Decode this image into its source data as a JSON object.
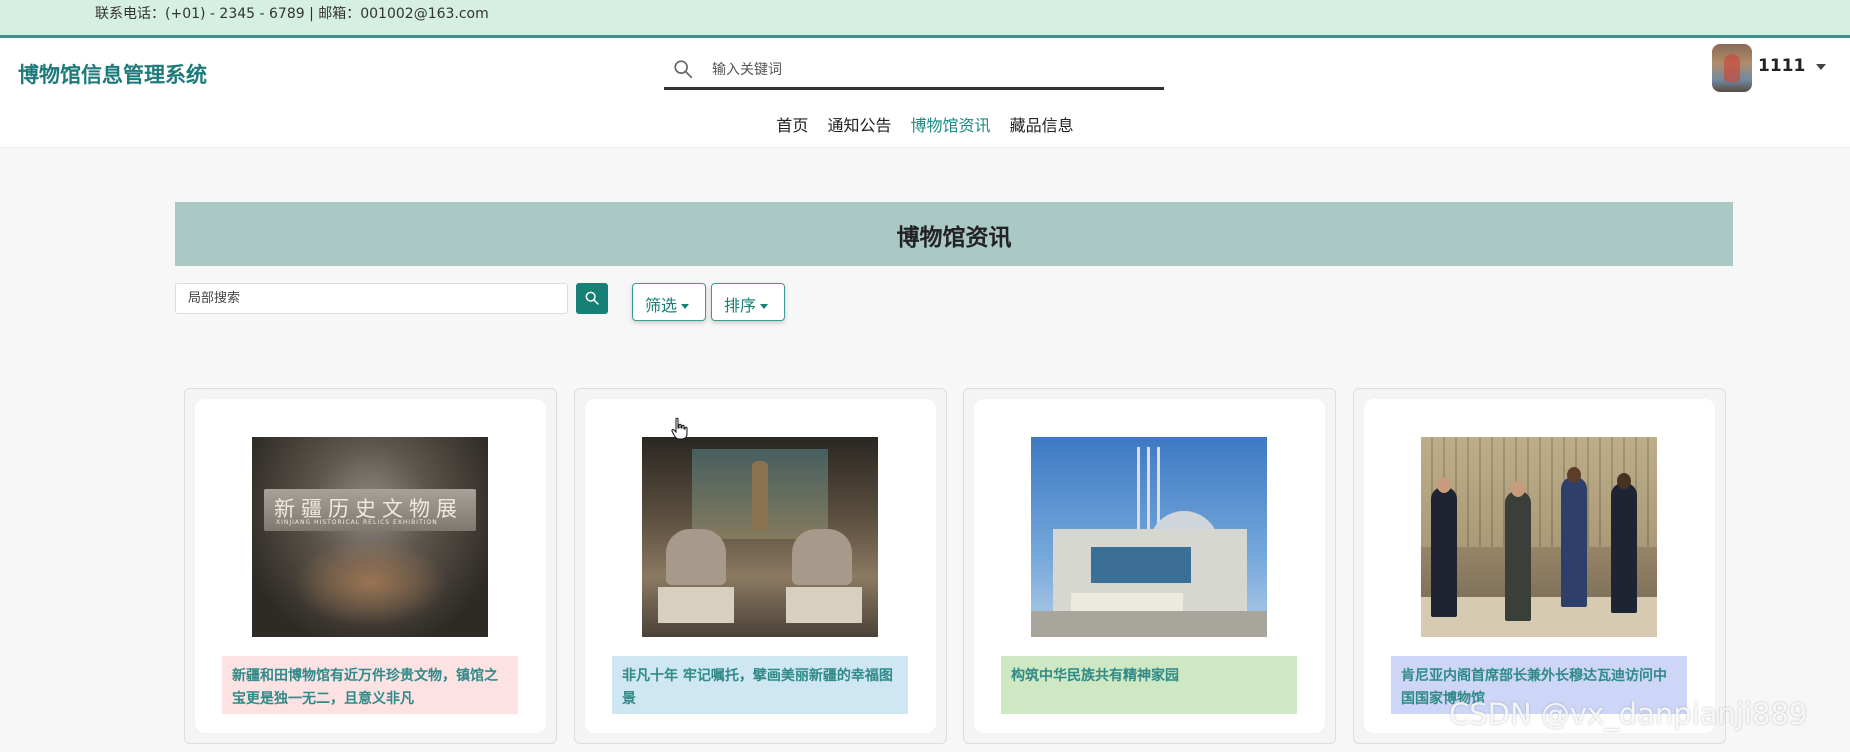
{
  "topbar": {
    "contact": "联系电话：(+01) - 2345 - 6789 | 邮箱：001002@163.com"
  },
  "header": {
    "logo": "博物馆信息管理系统",
    "search_placeholder": "输入关键词",
    "username": "1111"
  },
  "nav": {
    "items": [
      {
        "label": "首页",
        "active": false
      },
      {
        "label": "通知公告",
        "active": false
      },
      {
        "label": "博物馆资讯",
        "active": true
      },
      {
        "label": "藏品信息",
        "active": false
      }
    ]
  },
  "page": {
    "title": "博物馆资讯",
    "local_search_placeholder": "局部搜索",
    "filter_label": "筛选",
    "sort_label": "排序"
  },
  "cards": [
    {
      "title": "新疆和田博物馆有近万件珍贵文物，镇馆之宝更是独一无二，且意义非凡",
      "caption_bg": "#fde2e4",
      "plaque_text": "新疆历史文物展",
      "plaque_sub": "XINJIANG HISTORICAL RELICS EXHIBITION"
    },
    {
      "title": "非凡十年 牢记嘱托，擘画美丽新疆的幸福图景",
      "caption_bg": "#cfe6f3"
    },
    {
      "title": "构筑中华民族共有精神家园",
      "caption_bg": "#cde8c2"
    },
    {
      "title": "肯尼亚内阁首席部长兼外长穆达瓦迪访问中国国家博物馆",
      "caption_bg": "#cdd6f7"
    }
  ],
  "colors": {
    "brand": "#1d7a7a",
    "accent": "#168077",
    "topbar_bg": "#d5f0e2",
    "banner_bg": "#aac9c4"
  },
  "watermark": "CSDN @vx_danpianji889"
}
